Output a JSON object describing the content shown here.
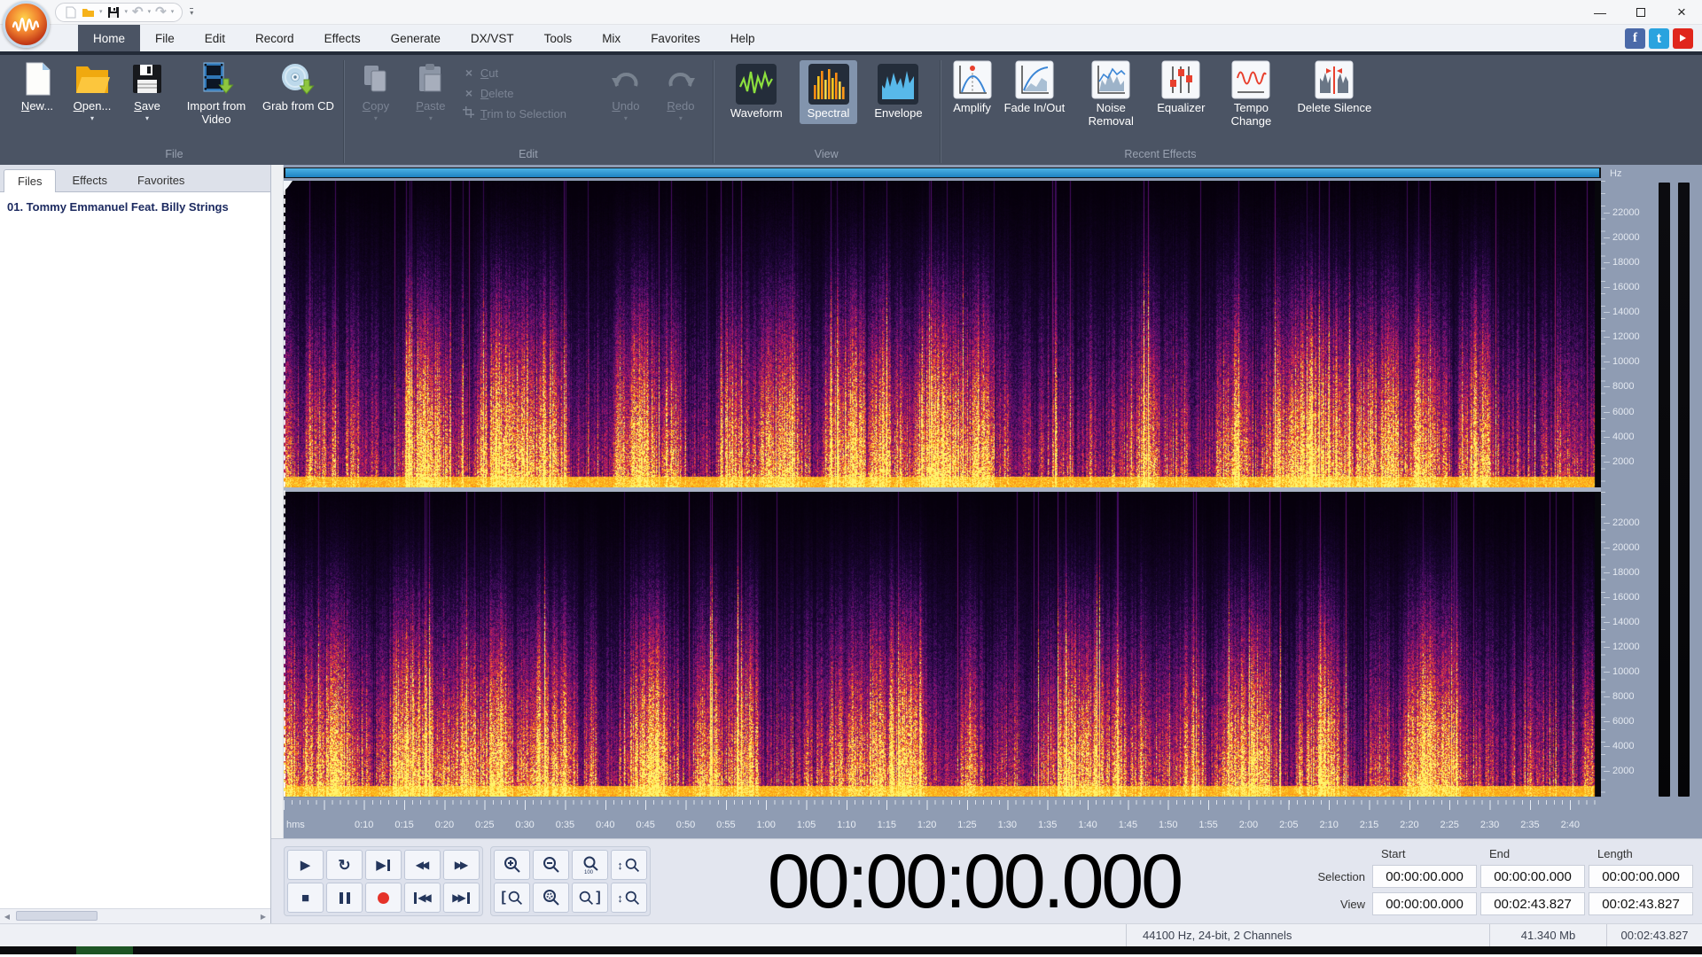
{
  "titlebar": {
    "quick_access": [
      "new",
      "open",
      "save",
      "undo",
      "redo"
    ],
    "window_buttons": {
      "minimize": "—",
      "close": "×"
    }
  },
  "social": [
    {
      "name": "facebook",
      "glyph": "f",
      "color": "#4a69a8"
    },
    {
      "name": "twitter",
      "glyph": "t",
      "color": "#2aa3df"
    },
    {
      "name": "youtube",
      "color": "#e0261c"
    }
  ],
  "menu": {
    "active_index": 0,
    "tabs": [
      {
        "label": "Home"
      },
      {
        "label": "File"
      },
      {
        "label": "Edit"
      },
      {
        "label": "Record"
      },
      {
        "label": "Effects"
      },
      {
        "label": "Generate"
      },
      {
        "label": "DX/VST"
      },
      {
        "label": "Tools"
      },
      {
        "label": "Mix"
      },
      {
        "label": "Favorites"
      },
      {
        "label": "Help"
      }
    ]
  },
  "ribbon": {
    "file": {
      "group_label": "File",
      "new": "New...",
      "open": "Open...",
      "save": "Save",
      "import_video": "Import from Video",
      "grab_cd": "Grab from CD"
    },
    "edit": {
      "group_label": "Edit",
      "copy": "Copy",
      "paste": "Paste",
      "cut": "Cut",
      "delete": "Delete",
      "trim": "Trim to Selection",
      "undo": "Undo",
      "redo": "Redo"
    },
    "view": {
      "group_label": "View",
      "waveform": "Waveform",
      "spectral": "Spectral",
      "envelope": "Envelope",
      "selected": "Spectral"
    },
    "recent_effects": {
      "group_label": "Recent Effects",
      "amplify": "Amplify",
      "fade": "Fade In/Out",
      "noise": "Noise Removal",
      "equalizer": "Equalizer",
      "tempo": "Tempo Change",
      "delete_silence": "Delete Silence"
    }
  },
  "sidebar": {
    "tabs": [
      {
        "label": "Files",
        "active": true
      },
      {
        "label": "Effects"
      },
      {
        "label": "Favorites"
      }
    ],
    "files": [
      "01. Tommy Emmanuel Feat. Billy Strings"
    ]
  },
  "spectral_view": {
    "freq_unit": "Hz",
    "freq_ticks": [
      22000,
      20000,
      18000,
      16000,
      14000,
      12000,
      10000,
      8000,
      6000,
      4000,
      2000
    ],
    "time_unit": "hms",
    "time_ticks": [
      "0:10",
      "0:15",
      "0:20",
      "0:25",
      "0:30",
      "0:35",
      "0:40",
      "0:45",
      "0:50",
      "0:55",
      "1:00",
      "1:05",
      "1:10",
      "1:15",
      "1:20",
      "1:25",
      "1:30",
      "1:35",
      "1:40",
      "1:45",
      "1:50",
      "1:55",
      "2:00",
      "2:05",
      "2:10",
      "2:15",
      "2:20",
      "2:25",
      "2:30",
      "2:35",
      "2:40"
    ],
    "channels": 2
  },
  "transport": {
    "play": "▶",
    "loop": "↻",
    "play_to_end": "▶",
    "rewind": "◀◀",
    "forward": "▶▶",
    "stop": "■",
    "record_color": "#e53229"
  },
  "time_display": {
    "value": "00:00:00.000"
  },
  "selection_panel": {
    "col_headers": [
      "Start",
      "End",
      "Length"
    ],
    "rows": [
      {
        "label": "Selection",
        "start": "00:00:00.000",
        "end": "00:00:00.000",
        "length": "00:00:00.000"
      },
      {
        "label": "View",
        "start": "00:00:00.000",
        "end": "00:02:43.827",
        "length": "00:02:43.827"
      }
    ]
  },
  "status_bar": {
    "audio_format": "44100 Hz, 24-bit, 2 Channels",
    "file_size": "41.340 Mb",
    "duration": "00:02:43.827"
  }
}
